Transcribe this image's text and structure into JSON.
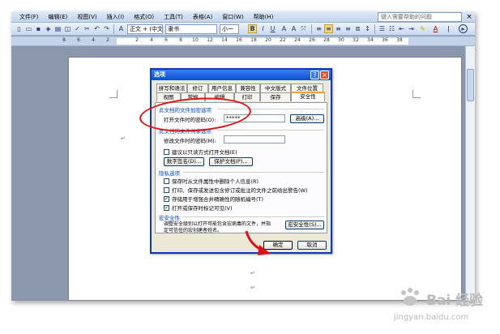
{
  "menubar": {
    "items": [
      "文件(F)",
      "编辑(E)",
      "视图(V)",
      "插入(I)",
      "格式(O)",
      "工具(T)",
      "表格(A)",
      "窗口(W)",
      "帮助(H)"
    ],
    "help_placeholder": "键入需要帮助的问题",
    "close_glyph": "×"
  },
  "toolbar": {
    "style_value": "正文 + (中文)",
    "font_value": "隶书",
    "size_value": "小一",
    "bold_label": "B",
    "italic_label": "I",
    "underline_label": "U",
    "font_color_label": "A"
  },
  "ruler": {
    "numbers": [
      "8",
      "6",
      "4",
      "2",
      "2",
      "4",
      "6",
      "8",
      "10",
      "12",
      "14",
      "16",
      "18",
      "20",
      "22",
      "24",
      "26",
      "28",
      "30",
      "32",
      "34",
      "36",
      "38"
    ]
  },
  "document": {
    "para_mark": "↵"
  },
  "dialog": {
    "title": "选项",
    "help_glyph": "?",
    "close_glyph": "×",
    "tabs_row1": [
      "拼写和语法",
      "修订",
      "用户信息",
      "兼容性",
      "中文版式",
      "文件位置"
    ],
    "tabs_row2": [
      "视图",
      "常规",
      "编辑",
      "打印",
      "保存",
      "安全性"
    ],
    "active_tab": "安全性",
    "open_section": {
      "heading": "此文档的文件加密选项",
      "password_label": "打开文件时的密码(O):",
      "password_value": "*****",
      "advanced_button": "高级(A)..."
    },
    "share_section": {
      "heading": "此文档的文件共享选项",
      "modify_label": "修改文件时的密码(M):",
      "readonly_label": "建议以只读方式打开文档(E)",
      "signature_button": "数字签名(D)...",
      "protect_button": "保护文档(P)..."
    },
    "privacy_section": {
      "heading": "隐私选项",
      "options": [
        {
          "label": "保存时从文件属性中删除个人信息(R)",
          "checked": false
        },
        {
          "label": "打印、保存或发送包含修订或批注的文件之前给出警告(W)",
          "checked": false
        },
        {
          "label": "存储用于增强合并精确性的随机编号(T)",
          "checked": true
        },
        {
          "label": "打开或保存时标记可见(V)",
          "checked": true
        }
      ]
    },
    "macro_section": {
      "heading": "宏安全性",
      "description_line1": "调整安全级别以打开可能包含宏病毒的文件，并指",
      "description_line2": "定可信任的宏创建者姓名。",
      "macro_button": "宏安全性(S)..."
    },
    "ok_button": "确定",
    "cancel_button": "取消"
  },
  "annotation": {
    "color": "#e01010"
  },
  "watermark": {
    "brand": "Bai 经验",
    "url": "jingyan.baidu.com"
  }
}
